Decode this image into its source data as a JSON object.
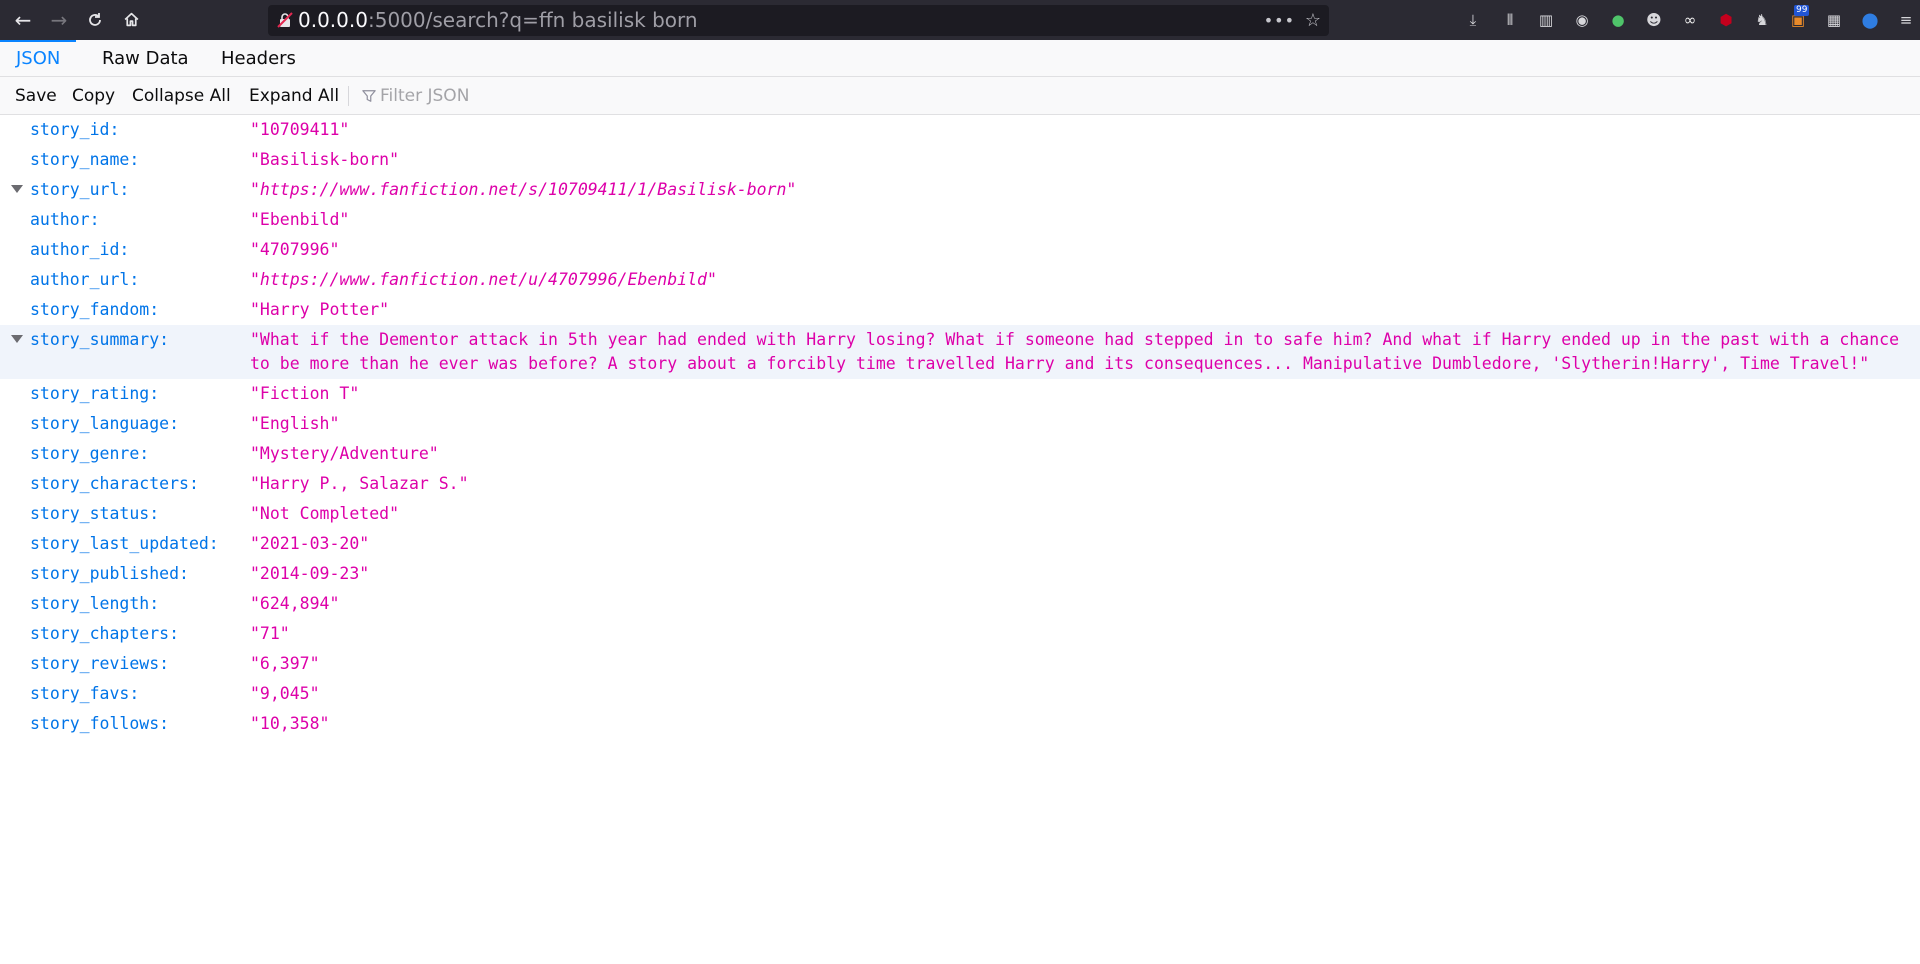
{
  "browser": {
    "url_host": "0.0.0.0",
    "url_rest": ":5000/search?q=ffn basilisk born",
    "more_label": "•••",
    "badge_count": "99",
    "toolbar_icons": [
      "download-icon",
      "library-icon",
      "sidebar-icon",
      "account-icon",
      "extension-green-icon",
      "extension-face-icon",
      "extension-glasses-icon",
      "ublock-icon",
      "extension-ghost-icon",
      "extension-badge-icon",
      "extension-grid-icon",
      "extension-shield-icon",
      "menu-icon"
    ]
  },
  "viewer": {
    "tabs": [
      {
        "label": "JSON",
        "active": true
      },
      {
        "label": "Raw Data",
        "active": false
      },
      {
        "label": "Headers",
        "active": false
      }
    ],
    "tools": {
      "save": "Save",
      "copy": "Copy",
      "collapse_all": "Collapse All",
      "expand_all": "Expand All",
      "filter_placeholder": "Filter JSON"
    }
  },
  "json_rows": [
    {
      "key": "story_id:",
      "value": "\"10709411\""
    },
    {
      "key": "story_name:",
      "value": "\"Basilisk-born\""
    },
    {
      "key": "story_url:",
      "value": "\"https://www.fanfiction.net/s/10709411/1/Basilisk-born\"",
      "url": true,
      "twisty": true
    },
    {
      "key": "author:",
      "value": "\"Ebenbild\""
    },
    {
      "key": "author_id:",
      "value": "\"4707996\""
    },
    {
      "key": "author_url:",
      "value": "\"https://www.fanfiction.net/u/4707996/Ebenbild\"",
      "url": true
    },
    {
      "key": "story_fandom:",
      "value": "\"Harry Potter\""
    },
    {
      "key": "story_summary:",
      "value": "\"What if the Dementor attack in 5th year had ended with Harry losing? What if someone had stepped in to safe him? And what if Harry ended up in the past with a chance to be more than he ever was before? A story about a forcibly time travelled Harry and its consequences... Manipulative Dumbledore, 'Slytherin!Harry', Time Travel!\"",
      "twisty": true,
      "selected": true
    },
    {
      "key": "story_rating:",
      "value": "\"Fiction T\""
    },
    {
      "key": "story_language:",
      "value": "\"English\""
    },
    {
      "key": "story_genre:",
      "value": "\"Mystery/Adventure\""
    },
    {
      "key": "story_characters:",
      "value": "\"Harry P., Salazar S.\""
    },
    {
      "key": "story_status:",
      "value": "\"Not Completed\""
    },
    {
      "key": "story_last_updated:",
      "value": "\"2021-03-20\""
    },
    {
      "key": "story_published:",
      "value": "\"2014-09-23\""
    },
    {
      "key": "story_length:",
      "value": "\"624,894\""
    },
    {
      "key": "story_chapters:",
      "value": "\"71\""
    },
    {
      "key": "story_reviews:",
      "value": "\"6,397\""
    },
    {
      "key": "story_favs:",
      "value": "\"9,045\""
    },
    {
      "key": "story_follows:",
      "value": "\"10,358\""
    }
  ]
}
